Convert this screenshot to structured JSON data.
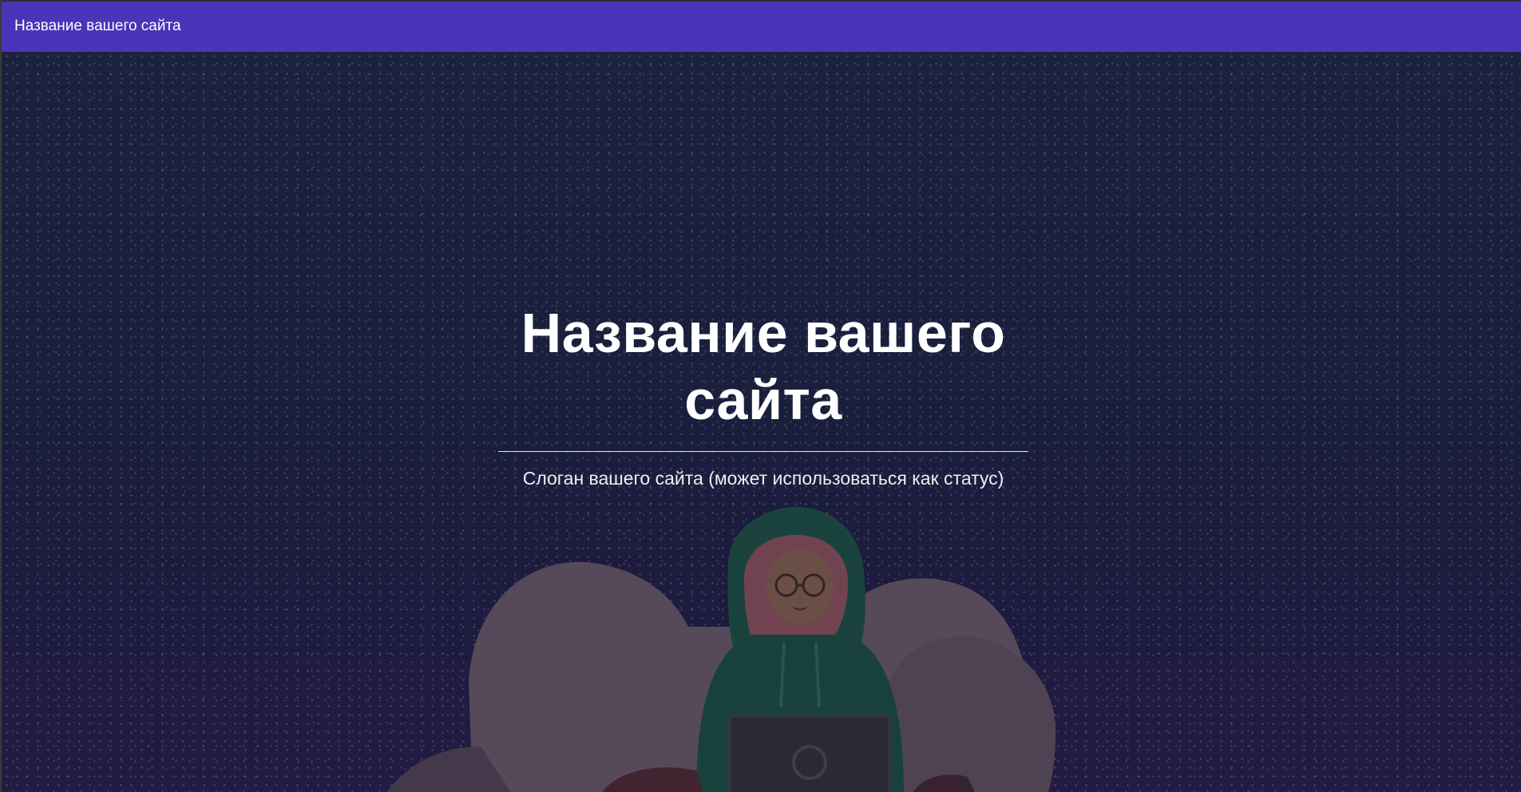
{
  "navbar": {
    "brand": "Название вашего сайта",
    "background": "#4a34b8"
  },
  "hero": {
    "title": "Название вашего сайта",
    "slogan": "Слоган вашего сайта (может использоваться как статус)",
    "illustration": "girl-in-hoodie-with-laptop-illustration"
  }
}
